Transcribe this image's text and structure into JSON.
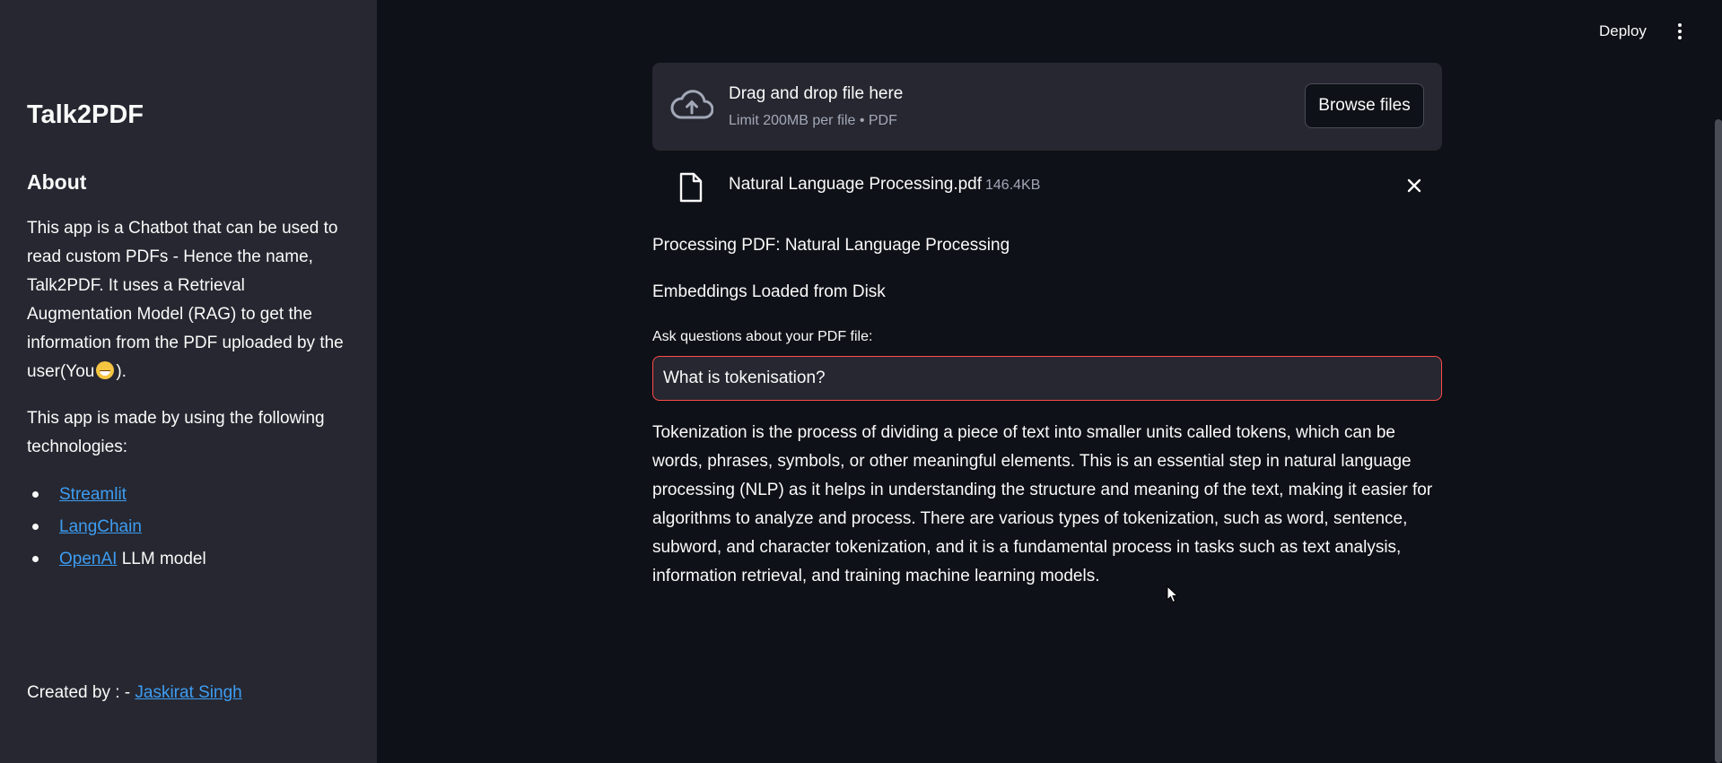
{
  "sidebar": {
    "title": "Talk2PDF",
    "about_heading": "About",
    "about_text_before_emoji": "This app is a Chatbot that can be used to read custom PDFs - Hence the name, Talk2PDF. It uses a Retrieval Augmentation Model (RAG) to get the information from the PDF uploaded by the user(You",
    "about_text_after_emoji": ").",
    "tech_intro": "This app is made by using the following technologies:",
    "tech_list": [
      {
        "link": "Streamlit",
        "suffix": ""
      },
      {
        "link": "LangChain",
        "suffix": ""
      },
      {
        "link": "OpenAI",
        "suffix": " LLM model"
      }
    ],
    "created_by_label": "Created by : - ",
    "created_by_link": "Jaskirat Singh"
  },
  "header": {
    "deploy_label": "Deploy",
    "menu_icon": "more-vertical-icon"
  },
  "uploader": {
    "title": "Drag and drop file here",
    "limit": "Limit 200MB per file • PDF",
    "browse_label": "Browse files",
    "icon": "cloud-upload-icon",
    "file": {
      "name": "Natural Language Processing.pdf",
      "size": "146.4KB",
      "icon": "file-icon"
    }
  },
  "status": {
    "processing": "Processing PDF: Natural Language Processing",
    "embeddings": "Embeddings Loaded from Disk"
  },
  "query": {
    "label": "Ask questions about your PDF file:",
    "value": "What is tokenisation?"
  },
  "answer": "Tokenization is the process of dividing a piece of text into smaller units called tokens, which can be words, phrases, symbols, or other meaningful elements. This is an essential step in natural language processing (NLP) as it helps in understanding the structure and meaning of the text, making it easier for algorithms to analyze and process. There are various types of tokenization, such as word, sentence, subword, and character tokenization, and it is a fundamental process in tasks such as text analysis, information retrieval, and training machine learning models.",
  "colors": {
    "background": "#0e1117",
    "sidebar": "#262730",
    "link": "#3d9df3",
    "input_focus_border": "#ff4b4b"
  }
}
